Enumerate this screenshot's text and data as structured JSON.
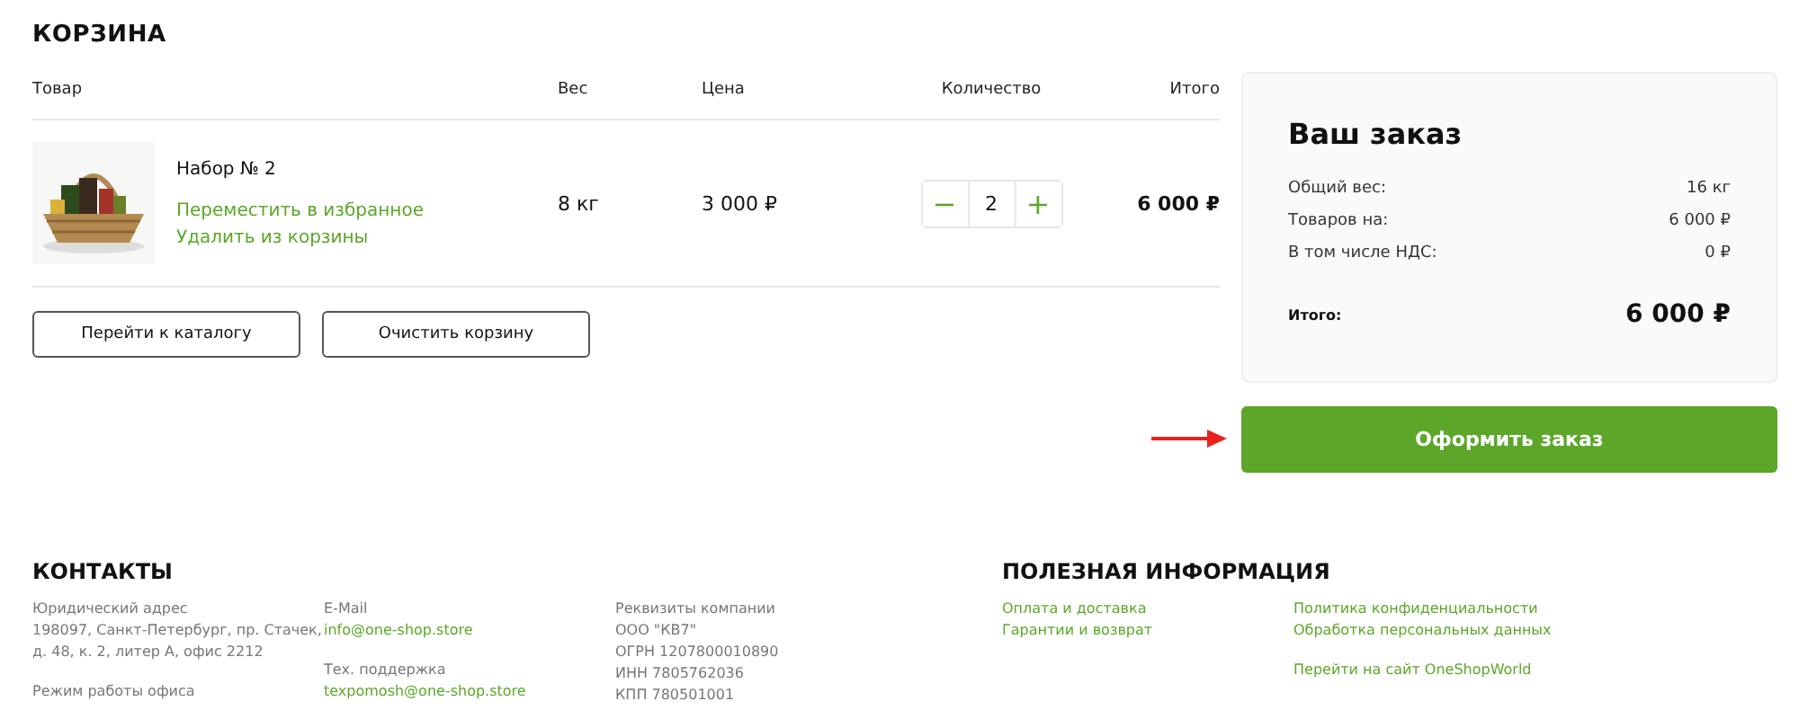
{
  "cart": {
    "title": "КОРЗИНА",
    "columns": [
      "Товар",
      "Вес",
      "Цена",
      "Количество",
      "Итого"
    ],
    "items": [
      {
        "image": {
          "kind": "picture"
        },
        "name": "Набор № 2",
        "actions": [
          "Переместить в избранное",
          "Удалить из корзины"
        ],
        "weight": "8 кг",
        "price": "3 000 ₽",
        "quantity": {
          "minus": "−",
          "value": "2",
          "plus": "+"
        },
        "total": "6 000 ₽"
      }
    ],
    "buttons": [
      "Перейти к каталогу",
      "Очистить корзину"
    ]
  },
  "summary": {
    "title": "Ваш заказ",
    "rows": [
      {
        "label": "Общий вес:",
        "value": "16 кг"
      },
      {
        "label": "Товаров на:",
        "value": "6 000 ₽"
      },
      {
        "label": "В том числе НДС:",
        "value": "0 ₽"
      }
    ],
    "total": {
      "label": "Итого:",
      "value": "6 000 ₽"
    },
    "checkout_button": "Оформить заказ"
  },
  "footer": {
    "contacts": {
      "title": "КОНТАКТЫ",
      "columns": [
        [
          {
            "kind": "label",
            "text": "Юридический адрес"
          },
          {
            "kind": "text",
            "text": "198097, Санкт-Петербург, пр. Стачек, д. 48, к. 2, литер А, офис 2212"
          },
          {
            "kind": "gap"
          },
          {
            "kind": "label",
            "text": "Режим работы офиса"
          }
        ],
        [
          {
            "kind": "label",
            "text": "E-Mail"
          },
          {
            "kind": "link",
            "text": "info@one-shop.store"
          },
          {
            "kind": "gap"
          },
          {
            "kind": "label",
            "text": "Тех. поддержка"
          },
          {
            "kind": "link",
            "text": "texpomosh@one-shop.store"
          }
        ],
        [
          {
            "kind": "label",
            "text": "Реквизиты компании"
          },
          {
            "kind": "text",
            "text": "ООО \"КВ7\""
          },
          {
            "kind": "text",
            "text": "ОГРН 1207800010890"
          },
          {
            "kind": "text",
            "text": "ИНН 7805762036"
          },
          {
            "kind": "text",
            "text": "КПП 780501001"
          }
        ]
      ]
    },
    "info": {
      "title": "ПОЛЕЗНАЯ ИНФОРМАЦИЯ",
      "columns": [
        [
          {
            "kind": "link",
            "text": "Оплата и доставка"
          },
          {
            "kind": "link",
            "text": "Гарантии и возврат"
          }
        ],
        [
          {
            "kind": "link",
            "text": "Политика конфиденциальности"
          },
          {
            "kind": "link",
            "text": "Обработка персональных данных"
          },
          {
            "kind": "gap"
          },
          {
            "kind": "link",
            "text": "Перейти на сайт OneShopWorld"
          }
        ]
      ]
    }
  }
}
